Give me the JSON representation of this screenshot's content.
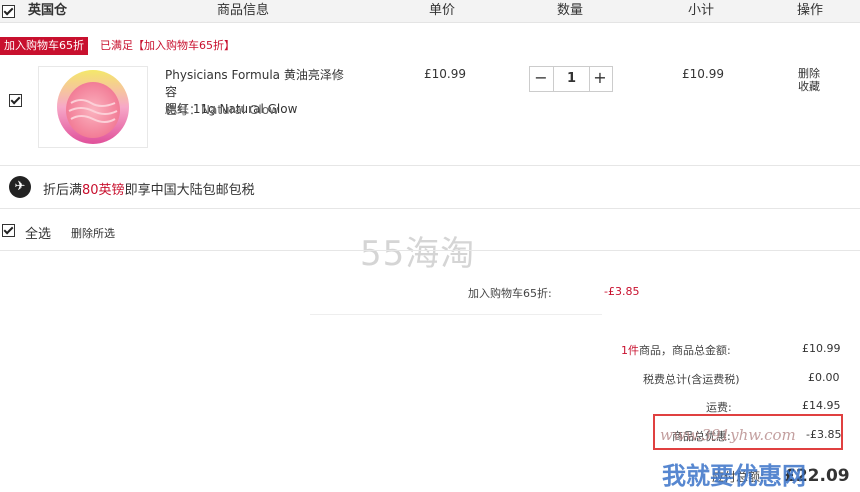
{
  "header": {
    "warehouse": "英国仓",
    "col_product": "商品信息",
    "col_price": "单价",
    "col_qty": "数量",
    "col_subtotal": "小计",
    "col_action": "操作"
  },
  "promo": {
    "badge": "加入购物车65折",
    "note": "已满足【加入购物车65折】"
  },
  "item": {
    "name_line1": "Physicians Formula 黄油亮泽修容",
    "name_line2": "腮红 11g Natural Glow",
    "shade": "色号：Natural Glow",
    "price": "£10.99",
    "qty": "1",
    "minus": "−",
    "plus": "+",
    "subtotal": "£10.99",
    "action_delete": "删除",
    "action_save": "收藏",
    "thumb_icon": "blush-compact-image"
  },
  "shipping": {
    "icon": "airplane-icon",
    "prefix": "折后满",
    "highlight": "80英镑",
    "suffix": "即享中国大陆包邮包税"
  },
  "footer": {
    "select_all": "全选",
    "delete_selected": "删除所选"
  },
  "watermark_center": "55海淘",
  "summary": {
    "discount_label": "加入购物车65折:",
    "discount_value": "-£3.85",
    "items_count": "1件",
    "items_label": "商品，商品总金额:",
    "items_value": "£10.99",
    "tax_label": "税费总计(含运费税)",
    "tax_value": "£0.00",
    "shipping_label": "运费:",
    "shipping_value": "£14.95",
    "promo_label": "商品总优惠:",
    "promo_value": "-£3.85",
    "total_label": "应付总额:",
    "total_value": "£22.09"
  },
  "watermark_url": "www.391yhw.com",
  "watermark_brand": "我就要优惠网",
  "colors": {
    "accent": "#c8102e",
    "header_bg": "#f3f3f3"
  }
}
